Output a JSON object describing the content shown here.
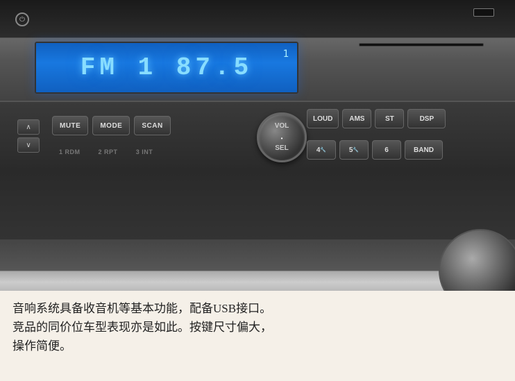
{
  "display": {
    "text": "FM 1  87.5",
    "indicator": "1",
    "background_color": "#1060c0"
  },
  "buttons": {
    "power_label": "⏻",
    "arrow_up": "∧",
    "arrow_down": "∨",
    "mute": "MUTE",
    "mode": "MODE",
    "scan": "SCAN",
    "sub1": "1 RDM",
    "sub2": "2 RPT",
    "sub3": "3 INT",
    "vol": "VOL",
    "sel": "SEL",
    "vol_dot": "•",
    "loud": "LOUD",
    "ams": "AMS",
    "st": "ST",
    "dsp": "DSP",
    "num4": "4 🔧",
    "num5": "5 🔧",
    "num6": "6",
    "band": "BAND"
  },
  "caption": {
    "line1": "音响系统具备收音机等基本功能，配备USB接口。",
    "line2": "竞品的同价位车型表现亦是如此。按键尺寸偏大，",
    "line3": "操作简便。"
  }
}
